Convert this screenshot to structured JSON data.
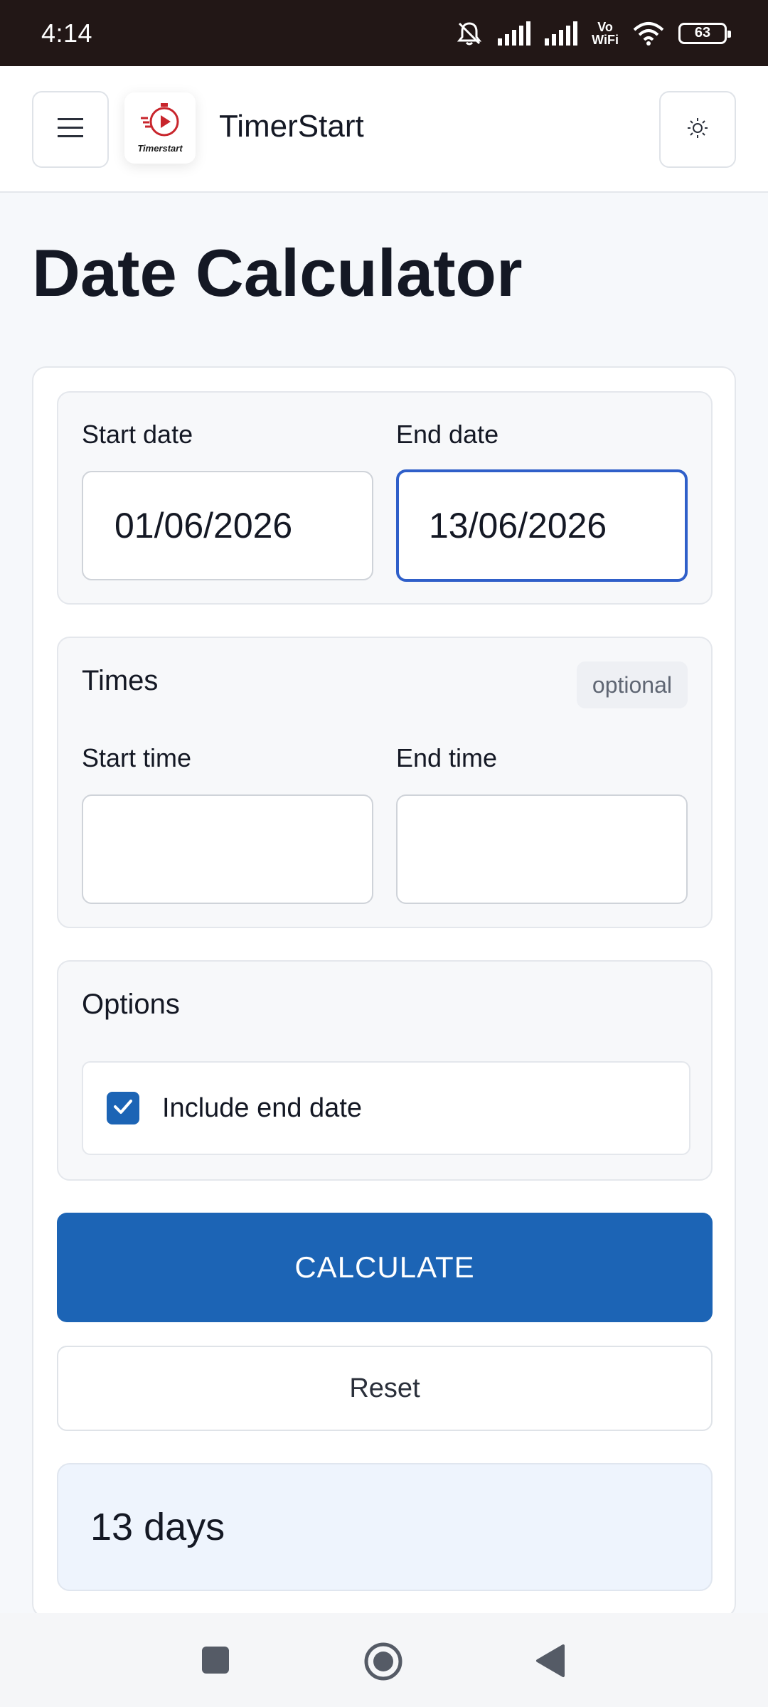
{
  "status_bar": {
    "time": "4:14",
    "network_label": "Vo\nWiFi",
    "battery": "63",
    "icons": [
      "mute-icon",
      "signal-icon",
      "signal-icon",
      "vowifi-icon",
      "wifi-icon",
      "battery-icon"
    ]
  },
  "header": {
    "app_name": "TimerStart",
    "logo_text": "Timerstart",
    "menu_icon": "hamburger-icon",
    "theme_icon": "sun-icon"
  },
  "page": {
    "title": "Date Calculator"
  },
  "dates": {
    "start_label": "Start date",
    "start_value": "01/06/2026",
    "end_label": "End date",
    "end_value": "13/06/2026"
  },
  "times": {
    "title": "Times",
    "badge": "optional",
    "start_label": "Start time",
    "start_value": "",
    "end_label": "End time",
    "end_value": ""
  },
  "options": {
    "title": "Options",
    "include_end_date_label": "Include end date",
    "include_end_date_checked": true
  },
  "actions": {
    "calculate_label": "CALCULATE",
    "reset_label": "Reset"
  },
  "result": {
    "text": "13 days"
  },
  "colors": {
    "primary": "#1c64b5",
    "focus_border": "#2f5fc9",
    "result_bg": "#eef4fd",
    "status_bar_bg": "#221716",
    "logo_accent": "#c8252c"
  },
  "nav_bar": {
    "icons": [
      "recent-apps-icon",
      "home-icon",
      "back-icon"
    ]
  }
}
